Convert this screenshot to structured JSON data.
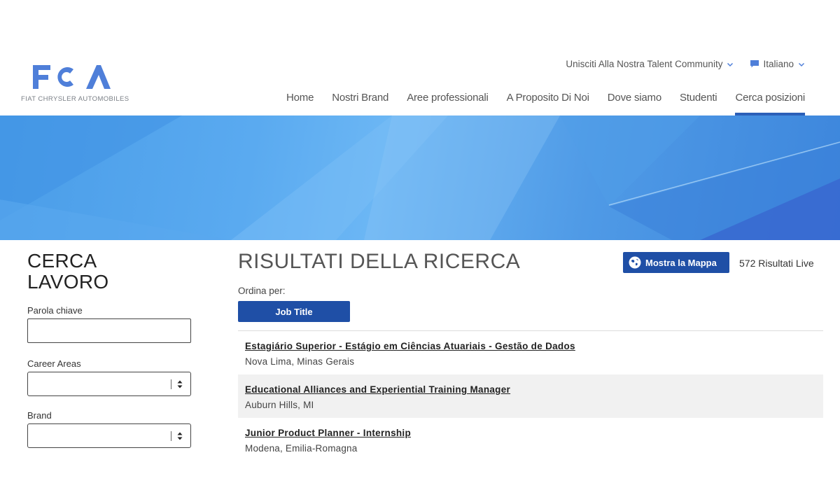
{
  "brand": {
    "logo_text": "FCA",
    "logo_subtitle": "FIAT CHRYSLER AUTOMOBILES",
    "accent_color": "#2b5fb8",
    "button_color": "#1f4fa6"
  },
  "utility": {
    "talent_community": "Unisciti Alla Nostra Talent Community",
    "language": "Italiano"
  },
  "nav": {
    "items": [
      {
        "label": "Home"
      },
      {
        "label": "Nostri Brand"
      },
      {
        "label": "Aree professionali"
      },
      {
        "label": "A Proposito Di Noi"
      },
      {
        "label": "Dove siamo"
      },
      {
        "label": "Studenti"
      },
      {
        "label": "Cerca posizioni",
        "active": true
      }
    ]
  },
  "sidebar": {
    "title_line1": "CERCA",
    "title_line2": "LAVORO",
    "keyword_label": "Parola chiave",
    "keyword_value": "",
    "career_areas_label": "Career Areas",
    "career_areas_value": "",
    "brand_label": "Brand",
    "brand_value": ""
  },
  "results": {
    "title": "RISULTATI DELLA RICERCA",
    "map_button": "Mostra la Mappa",
    "count": "572 Risultati Live",
    "sort_label": "Ordina per:",
    "sort_button": "Job Title",
    "jobs": [
      {
        "title": "Estagiário Superior - Estágio em Ciências Atuariais - Gestão de Dados",
        "location": "Nova Lima, Minas Gerais"
      },
      {
        "title": "Educational Alliances and Experiential Training Manager",
        "location": "Auburn Hills, MI"
      },
      {
        "title": "Junior Product Planner - Internship",
        "location": "Modena, Emilia-Romagna"
      }
    ]
  }
}
